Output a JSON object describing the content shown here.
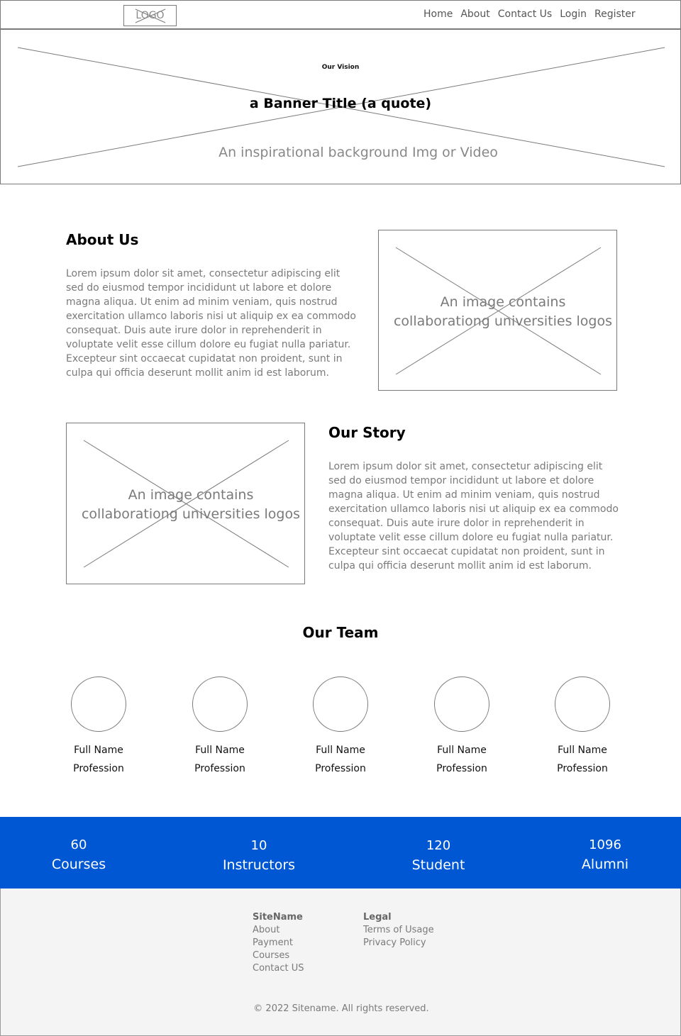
{
  "header": {
    "logo_text": "LOGO",
    "nav": [
      "Home",
      "About",
      "Contact Us",
      "Login",
      "Register"
    ]
  },
  "banner": {
    "eyebrow": "Our Vision",
    "title": "a Banner Title (a quote)",
    "subtitle": "An inspirational background Img or Video"
  },
  "about": {
    "title": "About Us",
    "text": "Lorem ipsum dolor sit amet, consectetur adipiscing elit\nsed do eiusmod tempor incididunt ut labore et dolore\nmagna aliqua. Ut enim ad minim veniam, quis nostrud\nexercitation ullamco laboris nisi ut aliquip ex ea commodo\n consequat. Duis aute irure dolor in reprehenderit in\nvoluptate velit esse cillum dolore eu fugiat nulla pariatur.\nExcepteur sint occaecat cupidatat non proident, sunt in\n culpa qui officia deserunt mollit anim id est laborum.",
    "image_caption": "An image contains\ncollaborationg universities logos"
  },
  "story": {
    "title": "Our Story",
    "text": "Lorem ipsum dolor sit amet, consectetur adipiscing elit\nsed do eiusmod tempor incididunt ut labore et dolore\nmagna aliqua. Ut enim ad minim veniam, quis nostrud\nexercitation ullamco laboris nisi ut aliquip ex ea commodo\n consequat. Duis aute irure dolor in reprehenderit in\nvoluptate velit esse cillum dolore eu fugiat nulla pariatur.\nExcepteur sint occaecat cupidatat non proident, sunt in\n culpa qui officia deserunt mollit anim id est laborum.",
    "image_caption": "An image contains\ncollaborationg universities logos"
  },
  "team": {
    "title": "Our Team",
    "members": [
      {
        "name": "Full Name",
        "profession": "Profession"
      },
      {
        "name": "Full Name",
        "profession": "Profession"
      },
      {
        "name": "Full Name",
        "profession": "Profession"
      },
      {
        "name": "Full Name",
        "profession": "Profession"
      },
      {
        "name": "Full Name",
        "profession": "Profession"
      }
    ]
  },
  "stats": [
    {
      "value": "60",
      "label": "Courses"
    },
    {
      "value": "10",
      "label": "Instructors"
    },
    {
      "value": "120",
      "label": "Student"
    },
    {
      "value": "1096",
      "label": "Alumni"
    }
  ],
  "footer": {
    "col1": {
      "heading": "SiteName",
      "links": [
        "About",
        "Payment",
        "Courses",
        "Contact US"
      ]
    },
    "col2": {
      "heading": "Legal",
      "links": [
        "Terms of Usage",
        "Privacy Policy"
      ]
    },
    "copyright": "© 2022 Sitename. All rights reserved."
  },
  "colors": {
    "stats_background": "#0057d4",
    "footer_background": "#f4f4f4",
    "placeholder_stroke": "#7a7a7a"
  }
}
